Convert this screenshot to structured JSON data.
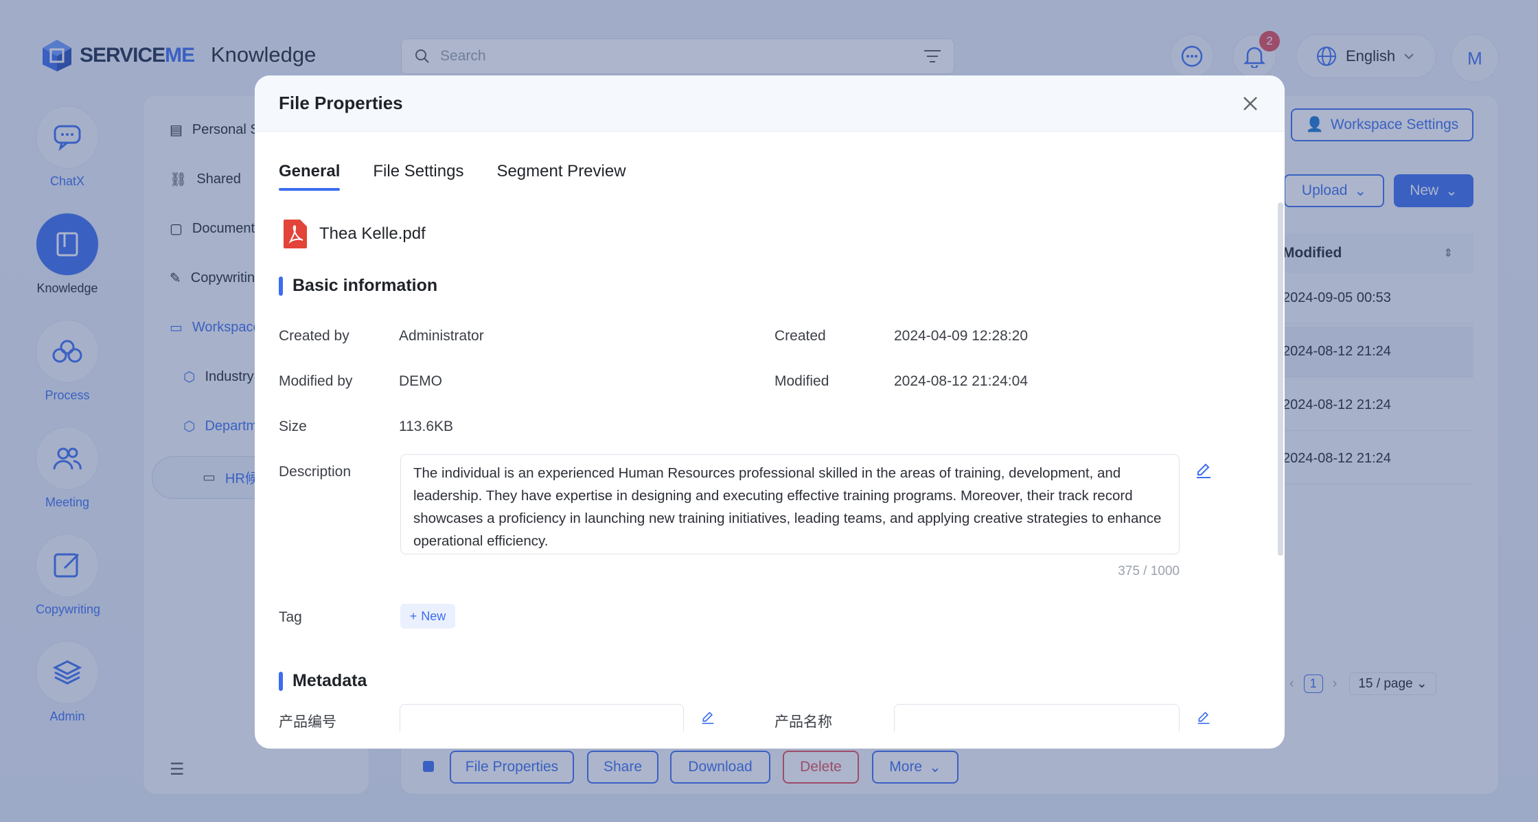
{
  "brand": {
    "logo_main": "SERVICE",
    "logo_accent": "ME",
    "app_title": "Knowledge"
  },
  "search": {
    "placeholder": "Search"
  },
  "header": {
    "notification_count": "2",
    "language": "English",
    "avatar_initial": "M"
  },
  "rail": [
    {
      "label": "ChatX",
      "icon": "chat-icon"
    },
    {
      "label": "Knowledge",
      "icon": "book-icon"
    },
    {
      "label": "Process",
      "icon": "workflow-icon"
    },
    {
      "label": "Meeting",
      "icon": "people-icon"
    },
    {
      "label": "Copywriting",
      "icon": "edit-square-icon"
    },
    {
      "label": "Admin",
      "icon": "layers-icon"
    }
  ],
  "tree": {
    "items": [
      {
        "label": "Personal S",
        "icon": "personal-icon"
      },
      {
        "label": "Shared",
        "icon": "link-icon"
      },
      {
        "label": "Document",
        "icon": "document-icon"
      },
      {
        "label": "Copywritin",
        "icon": "edit-icon"
      },
      {
        "label": "Workspace",
        "icon": "folder-open-icon"
      },
      {
        "label": "Industry",
        "icon": "cube-icon"
      },
      {
        "label": "Departm",
        "icon": "cube-icon"
      },
      {
        "label": "HR候",
        "icon": "folder-icon"
      }
    ]
  },
  "main": {
    "workspace_settings": "Workspace Settings",
    "upload": "Upload",
    "new": "New",
    "column_modified": "Modified",
    "rows": [
      "2024-09-05 00:53",
      "2024-08-12 21:24",
      "2024-08-12 21:24",
      "2024-08-12 21:24"
    ],
    "pager": {
      "page": "1",
      "page_size": "15 / page"
    },
    "actions": {
      "file_properties": "File Properties",
      "share": "Share",
      "download": "Download",
      "delete": "Delete",
      "more": "More"
    }
  },
  "modal": {
    "title": "File Properties",
    "tabs": [
      "General",
      "File Settings",
      "Segment Preview"
    ],
    "file_name": "Thea Kelle.pdf",
    "basic_section": "Basic information",
    "fields": {
      "created_by_label": "Created by",
      "created_by": "Administrator",
      "created_label": "Created",
      "created": "2024-04-09 12:28:20",
      "modified_by_label": "Modified by",
      "modified_by": "DEMO",
      "modified_label": "Modified",
      "modified": "2024-08-12 21:24:04",
      "size_label": "Size",
      "size": "113.6KB",
      "description_label": "Description",
      "description": "The individual is an experienced Human Resources professional skilled in the areas of training, development, and leadership. They have expertise in designing and executing effective training programs. Moreover, their track record showcases a proficiency in launching new training initiatives, leading teams, and applying creative strategies to enhance operational efficiency.",
      "description_counter": "375 / 1000",
      "tag_label": "Tag",
      "tag_new": "New"
    },
    "metadata_section": "Metadata",
    "metadata_fields": [
      {
        "label": "产品编号"
      },
      {
        "label": "产品名称"
      }
    ]
  },
  "colors": {
    "accent": "#3c6df0",
    "danger": "#e34d59",
    "pdf": "#e2443a"
  }
}
